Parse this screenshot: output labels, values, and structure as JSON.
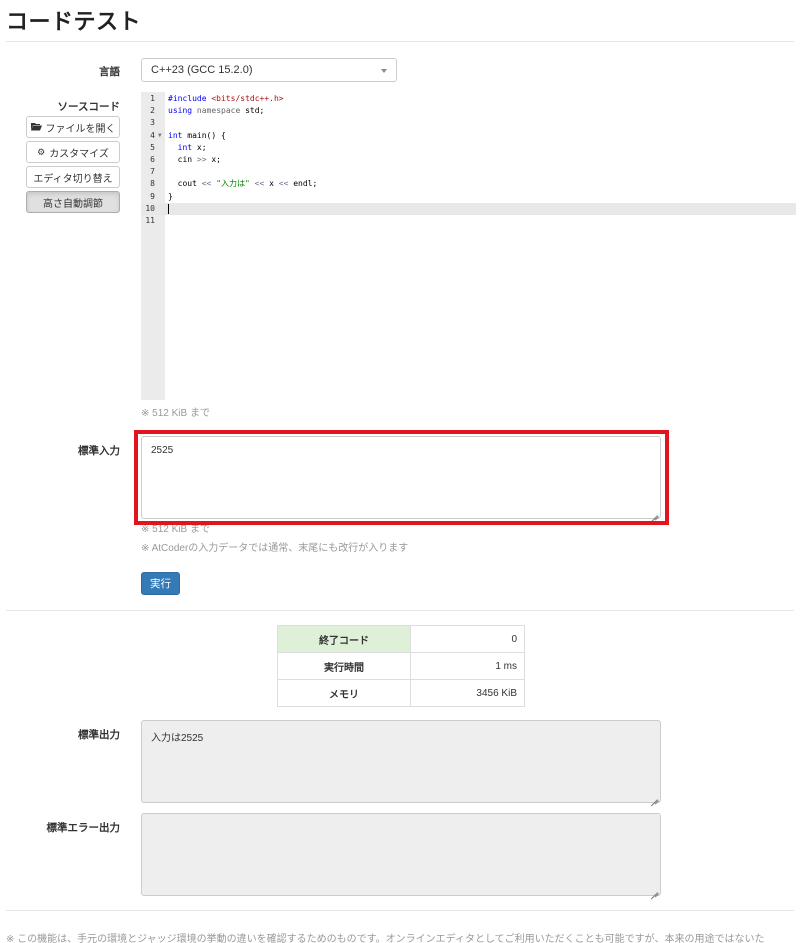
{
  "page": {
    "title": "コードテスト"
  },
  "language": {
    "label": "言語",
    "selected": "C++23 (GCC 15.2.0)"
  },
  "source": {
    "label": "ソースコード",
    "buttons": [
      {
        "label": "ファイルを開く",
        "icon": "folder-open-icon"
      },
      {
        "label": "カスタマイズ",
        "icon": "gear-icon"
      },
      {
        "label": "エディタ切り替え",
        "icon": ""
      },
      {
        "label": "高さ自動調節",
        "icon": ""
      }
    ],
    "line_numbers": [
      "1",
      "2",
      "3",
      "4",
      "5",
      "6",
      "7",
      "8",
      "9",
      "10",
      "11"
    ],
    "code_lines": [
      "#include <bits/stdc++.h>",
      "using namespace std;",
      "",
      "int main() {",
      "  int x;",
      "  cin >> x;",
      "",
      "  cout << \"入力は\" << x << endl;",
      "}",
      "",
      ""
    ],
    "active_line": "10",
    "limit_note": "※ 512 KiB まで"
  },
  "stdin": {
    "label": "標準入力",
    "value": "2525",
    "limit_note": "※ 512 KiB まで",
    "newline_note": "※ AtCoderの入力データでは通常、末尾にも改行が入ります"
  },
  "run_button": {
    "label": "実行"
  },
  "result": {
    "rows": [
      {
        "key": "終了コード",
        "value": "0"
      },
      {
        "key": "実行時間",
        "value": "1 ms"
      },
      {
        "key": "メモリ",
        "value": "3456 KiB"
      }
    ]
  },
  "stdout": {
    "label": "標準出力",
    "value": "入力は2525"
  },
  "stderr": {
    "label": "標準エラー出力",
    "value": ""
  },
  "footer": {
    "note": "※ この機能は、手元の環境とジャッジ環境の挙動の違いを確認するためのものです。オンラインエディタとしてご利用いただくことも可能ですが、本来の用途ではないた"
  },
  "colors": {
    "highlight": "#e0151e",
    "run_button": "#337ab7",
    "success_cell": "#dff0d8"
  }
}
